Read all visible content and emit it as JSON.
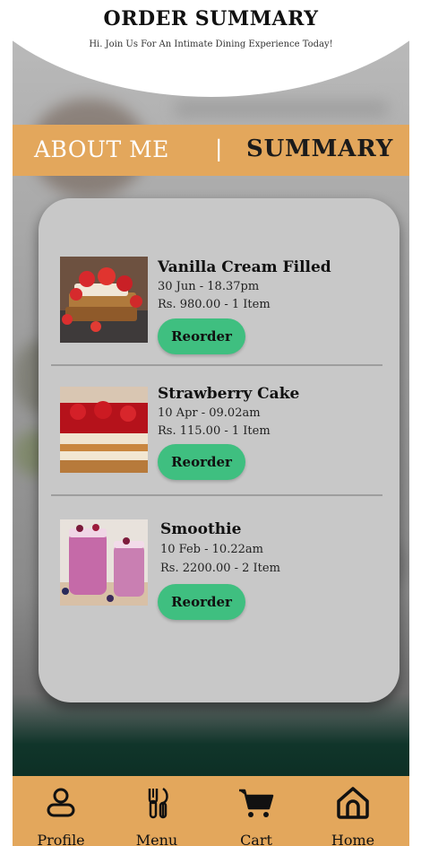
{
  "header": {
    "title": "ORDER SUMMARY",
    "subtitle": "Hi. Join Us For An Intimate Dining Experience Today!"
  },
  "tabs": {
    "about": "ABOUT ME",
    "separator": "|",
    "summary": "SUMMARY"
  },
  "orders": [
    {
      "name": "Vanilla Cream Filled",
      "date": "30 Jun - 18.37pm",
      "price": "Rs. 980.00 - 1 Item",
      "button": "Reorder"
    },
    {
      "name": "Strawberry Cake",
      "date": "10 Apr - 09.02am",
      "price": "Rs. 115.00 - 1 Item",
      "button": "Reorder"
    },
    {
      "name": "Smoothie",
      "date": "10 Feb - 10.22am",
      "price": "Rs. 2200.00 - 2 Item",
      "button": "Reorder"
    }
  ],
  "nav": [
    {
      "label": "Profile",
      "icon": "profile-icon"
    },
    {
      "label": "Menu",
      "icon": "menu-utensils-icon"
    },
    {
      "label": "Cart",
      "icon": "cart-icon"
    },
    {
      "label": "Home",
      "icon": "home-icon"
    }
  ],
  "colors": {
    "accent": "#e3a75c",
    "button": "#3fbf80",
    "card": "#c8c8c8"
  }
}
